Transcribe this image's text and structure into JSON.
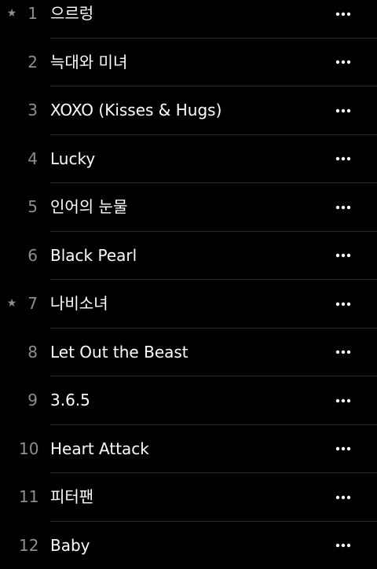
{
  "tracks": [
    {
      "number": "1",
      "title": "으르렁",
      "starred": true
    },
    {
      "number": "2",
      "title": "늑대와 미녀",
      "starred": false
    },
    {
      "number": "3",
      "title": "XOXO (Kisses & Hugs)",
      "starred": false
    },
    {
      "number": "4",
      "title": "Lucky",
      "starred": false
    },
    {
      "number": "5",
      "title": "인어의 눈물",
      "starred": false
    },
    {
      "number": "6",
      "title": "Black Pearl",
      "starred": false
    },
    {
      "number": "7",
      "title": "나비소녀",
      "starred": true
    },
    {
      "number": "8",
      "title": "Let Out the Beast",
      "starred": false
    },
    {
      "number": "9",
      "title": "3.6.5",
      "starred": false
    },
    {
      "number": "10",
      "title": "Heart Attack",
      "starred": false
    },
    {
      "number": "11",
      "title": "피터팬",
      "starred": false
    },
    {
      "number": "12",
      "title": "Baby",
      "starred": false
    }
  ],
  "icons": {
    "star": "star-icon",
    "more": "more-options-icon"
  },
  "colors": {
    "background": "#000000",
    "title": "#ffffff",
    "number": "#8e8e93",
    "divider": "#2a2a2c"
  }
}
